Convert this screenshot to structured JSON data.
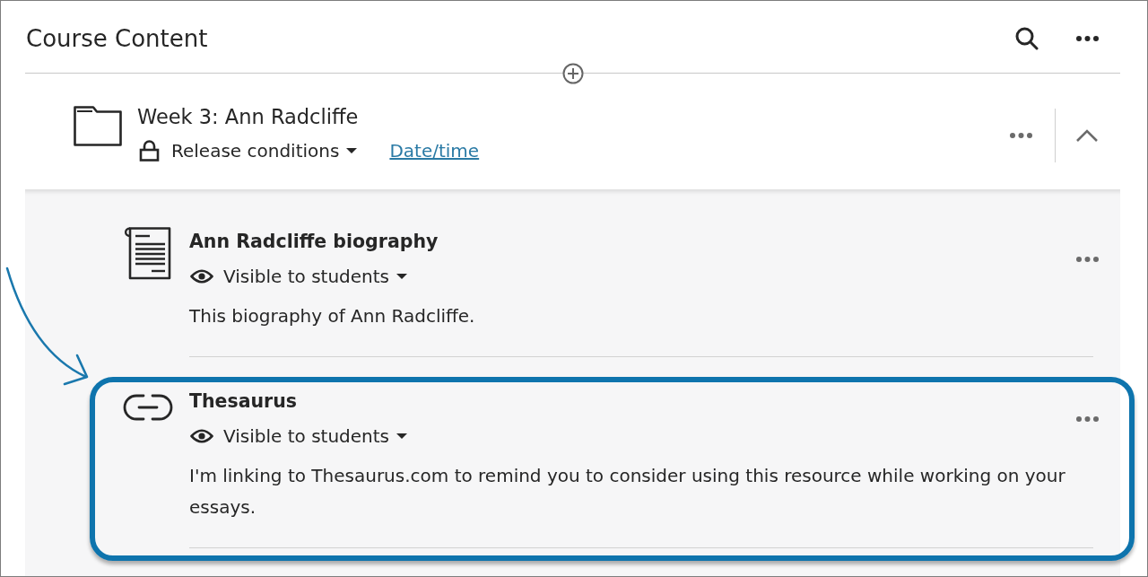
{
  "header": {
    "title": "Course Content"
  },
  "folder": {
    "title": "Week 3: Ann Radcliffe",
    "expanded": true,
    "release_conditions": "Release conditions",
    "date_link": "Date/time",
    "items": [
      {
        "kind": "document",
        "title": "Ann Radcliffe biography",
        "visibility": "Visible to students",
        "description": "This biography of Ann Radcliffe.",
        "highlighted": false
      },
      {
        "kind": "link",
        "title": "Thesaurus",
        "visibility": "Visible to students",
        "description": "I'm linking to Thesaurus.com to remind you to consider using this resource while working on your essays.",
        "highlighted": true
      }
    ]
  }
}
